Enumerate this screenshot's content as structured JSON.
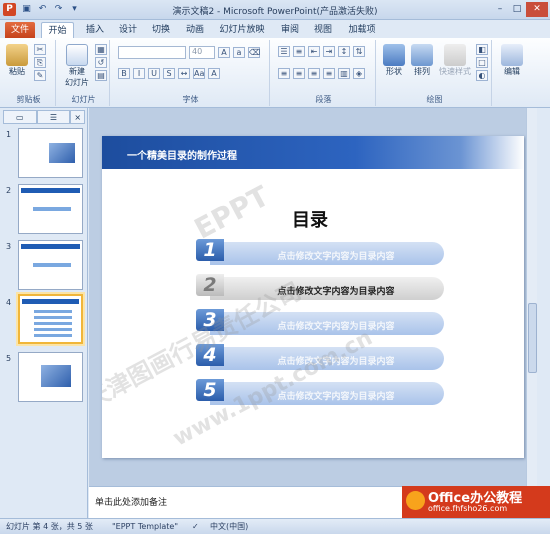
{
  "window": {
    "title": "演示文稿2 - Microsoft PowerPoint(产品激活失败)",
    "app_icon": "P"
  },
  "tabs": [
    "文件",
    "开始",
    "插入",
    "设计",
    "切换",
    "动画",
    "幻灯片放映",
    "审阅",
    "视图",
    "加载项"
  ],
  "ribbon": {
    "clipboard": {
      "label": "剪贴板",
      "paste": "粘贴"
    },
    "slides": {
      "label": "幻灯片",
      "new_slide": "新建\n幻灯片"
    },
    "font": {
      "label": "字体",
      "size": "40"
    },
    "paragraph": {
      "label": "段落"
    },
    "drawing": {
      "label": "绘图",
      "shapes": "形状",
      "arrange": "排列",
      "quick_styles": "快速样式"
    },
    "editing": {
      "label": "编辑"
    }
  },
  "panel_tabs": [
    "×"
  ],
  "thumbnails": [
    {
      "n": "1"
    },
    {
      "n": "2"
    },
    {
      "n": "3"
    },
    {
      "n": "4"
    },
    {
      "n": "5"
    }
  ],
  "slide": {
    "header": "一个精美目录的制作过程",
    "heading": "目录",
    "items": [
      {
        "n": "1",
        "text": "点击修改文字内容为目录内容"
      },
      {
        "n": "2",
        "text": "点击修改文字内容为目录内容"
      },
      {
        "n": "3",
        "text": "点击修改文字内容为目录内容"
      },
      {
        "n": "4",
        "text": "点击修改文字内容为目录内容"
      },
      {
        "n": "5",
        "text": "点击修改文字内容为目录内容"
      }
    ],
    "watermark": "EPPT",
    "watermark2": "天津图画行易责任公司",
    "watermark3": "www.1ppt.com.cn"
  },
  "notes_placeholder": "单击此处添加备注",
  "logo": {
    "title": "Office办公教程",
    "url": "office.fhfsho26.com"
  },
  "status": {
    "slide_info": "幻灯片 第 4 张，共 5 张",
    "theme": "\"EPPT Template\"",
    "language": "中文(中国)"
  }
}
